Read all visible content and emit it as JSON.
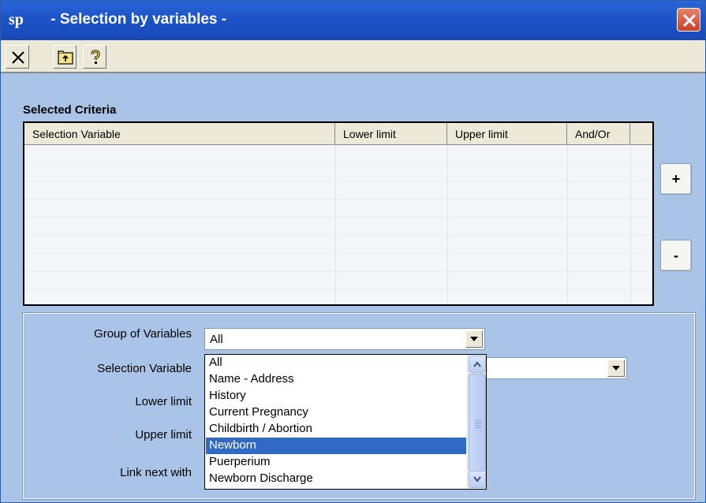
{
  "window": {
    "title": " - Selection by variables -",
    "app_icon_text": "sp"
  },
  "toolbar": {
    "buttons": [
      {
        "name": "close-x-icon"
      },
      {
        "name": "folder-up-icon"
      },
      {
        "name": "help-question-icon"
      }
    ]
  },
  "criteria": {
    "label": "Selected Criteria",
    "columns": [
      "Selection Variable",
      "Lower limit",
      "Upper limit",
      "And/Or"
    ],
    "rows": []
  },
  "side_buttons": {
    "add": "+",
    "remove": "-"
  },
  "form": {
    "group_label": "Group of Variables",
    "group_value": "All",
    "variable_label": "Selection Variable",
    "variable_value": "",
    "lower_label": "Lower limit",
    "upper_label": "Upper limit",
    "link_label": "Link next with"
  },
  "dropdown": {
    "items": [
      "All",
      "Name - Address",
      "History",
      "Current Pregnancy",
      "Childbirth / Abortion",
      "Newborn",
      "Puerperium",
      "Newborn Discharge"
    ],
    "selected": "Newborn"
  },
  "colors": {
    "titlebar": "#1d55c9",
    "window_bg": "#a9c4e6",
    "selection": "#316ac5",
    "close": "#c8412a"
  }
}
